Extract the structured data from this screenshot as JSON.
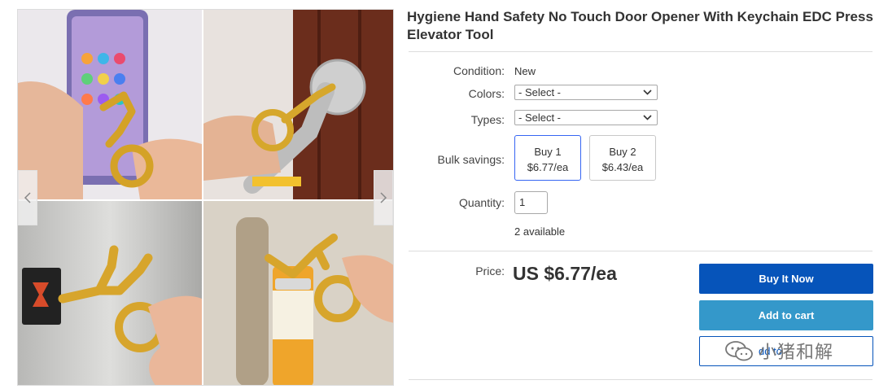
{
  "product": {
    "title": "Hygiene Hand Safety No Touch Door Opener With Keychain EDC Press Elevator Tool"
  },
  "gallery": {
    "images": [
      "phone-with-keychain-tool-photo",
      "door-handle-hook-photo",
      "elevator-button-press-photo",
      "bottle-opener-photo"
    ],
    "prev_icon": "chevron-left-icon",
    "next_icon": "chevron-right-icon"
  },
  "condition": {
    "label": "Condition:",
    "value": "New"
  },
  "colors": {
    "label": "Colors:",
    "selected": "- Select -"
  },
  "types": {
    "label": "Types:",
    "selected": "- Select -"
  },
  "bulk": {
    "label": "Bulk savings:",
    "options": [
      {
        "qty": "Buy 1",
        "price": "$6.77/ea",
        "selected": true
      },
      {
        "qty": "Buy 2",
        "price": "$6.43/ea",
        "selected": false
      }
    ]
  },
  "quantity": {
    "label": "Quantity:",
    "value": "1",
    "available": "2 available"
  },
  "price": {
    "label": "Price:",
    "value": "US $6.77/ea"
  },
  "actions": {
    "buy_now": "Buy It Now",
    "add_to_cart": "Add to cart",
    "watch_partial": "dd to"
  },
  "watermark": {
    "text": "小猪和解",
    "icon": "wechat-icon"
  },
  "colors_theme": {
    "buy_now": "#0654ba",
    "add_to_cart": "#3498ca",
    "selected_border": "#3665f3"
  }
}
